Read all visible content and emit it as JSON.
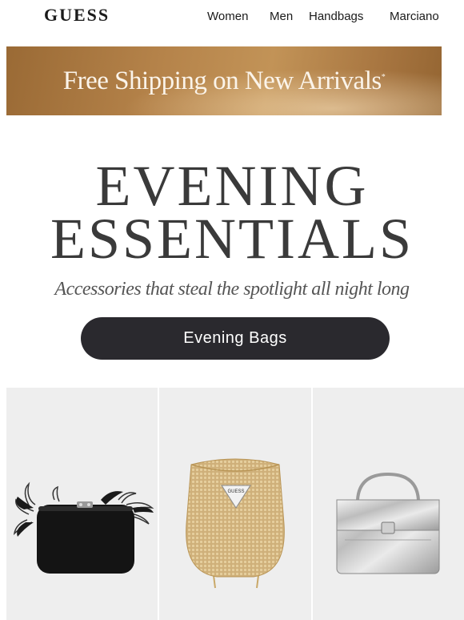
{
  "header": {
    "logo": "GUESS",
    "nav": [
      "Women",
      "Men",
      "Handbags",
      "Marciano"
    ]
  },
  "banner": {
    "text": "Free Shipping on New Arrivals",
    "mark": "*"
  },
  "hero": {
    "line1": "EVENING",
    "line2": "ESSENTIALS",
    "subtitle": "Accessories that steal the spotlight all night long",
    "cta_label": "Evening Bags"
  },
  "products": [
    {
      "icon": "black-feather-clutch-image"
    },
    {
      "icon": "gold-mesh-bucket-bag-image",
      "badge": "GUESS"
    },
    {
      "icon": "silver-top-handle-bag-image"
    }
  ],
  "colors": {
    "banner_gold": "#b5834a",
    "button_dark": "#2a292e",
    "tile_bg": "#eeeeee"
  }
}
